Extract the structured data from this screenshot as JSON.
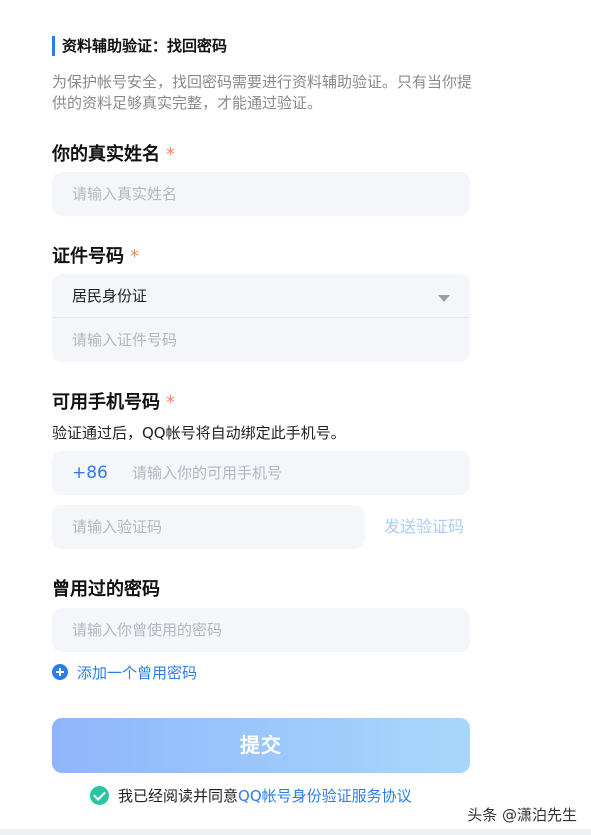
{
  "header": {
    "title": "资料辅助验证：找回密码",
    "description": "为保护帐号安全，找回密码需要进行资料辅助验证。只有当你提供的资料足够真实完整，才能通过验证。"
  },
  "form": {
    "required_mark": "*",
    "name": {
      "label": "你的真实姓名",
      "placeholder": "请输入真实姓名"
    },
    "id": {
      "label": "证件号码",
      "type_selected": "居民身份证",
      "placeholder": "请输入证件号码"
    },
    "phone": {
      "label": "可用手机号码",
      "hint": "验证通过后，QQ帐号将自动绑定此手机号。",
      "country_code": "+86",
      "placeholder": "请输入你的可用手机号",
      "code_placeholder": "请输入验证码",
      "send_code": "发送验证码"
    },
    "old_password": {
      "label": "曾用过的密码",
      "placeholder": "请输入你曾使用的密码",
      "add_more": "添加一个曾用密码"
    },
    "submit": "提交",
    "agreement": {
      "prefix": "我已经阅读并同意",
      "link": "QQ帐号身份验证服务协议",
      "checked": true
    }
  },
  "watermark": "头条 @潇泊先生",
  "colors": {
    "accent": "#2b7de9",
    "required": "#f08a5d",
    "check": "#28c5a5",
    "field_bg": "#f5f6f9"
  },
  "icons": {
    "dropdown": "chevron-down-icon",
    "add": "plus-circle-icon",
    "agree": "check-circle-icon"
  }
}
